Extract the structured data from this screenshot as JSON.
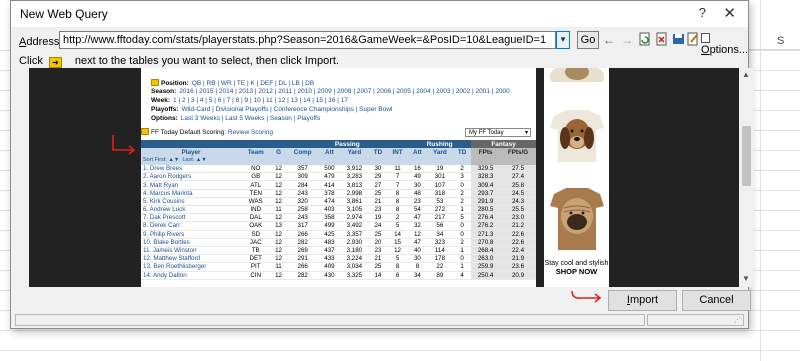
{
  "excel": {
    "column_label": "S"
  },
  "dialog": {
    "title": "New Web Query",
    "help": "?",
    "close": "✕",
    "address_label_underlined": "A",
    "address_label_rest": "ddress:",
    "address_value": "http://www.fftoday.com/stats/playerstats.php?Season=2016&GameWeek=&PosID=10&LeagueID=1",
    "go_label": "Go",
    "options_underlined": "O",
    "options_rest": "ptions...",
    "instruction_click": "Click",
    "instruction_rest": "next to the tables you want to select, then click Import.",
    "import_underlined": "I",
    "import_rest": "mport",
    "cancel_label": "Cancel"
  },
  "webpage": {
    "nav": {
      "position_label": "Position:",
      "positions": [
        "QB",
        "RB",
        "WR",
        "TE",
        "K",
        "DEF",
        "DL",
        "LB",
        "DB"
      ],
      "season_label": "Season:",
      "seasons": [
        "2016",
        "2015",
        "2014",
        "2013",
        "2012",
        "2011",
        "2010",
        "2009",
        "2008",
        "2007",
        "2006",
        "2005",
        "2004",
        "2003",
        "2002",
        "2001",
        "2000"
      ],
      "week_label": "Week:",
      "weeks": [
        "1",
        "2",
        "3",
        "4",
        "5",
        "6",
        "7",
        "8",
        "9",
        "10",
        "11",
        "12",
        "13",
        "14",
        "15",
        "16",
        "17"
      ],
      "playoffs_label": "Playoffs:",
      "playoffs": [
        "Wild-Card",
        "Divisional Playoffs",
        "Conference Championships",
        "Super Bowl"
      ],
      "options_label": "Options:",
      "options": [
        "Last 3 Weeks",
        "Last 5 Weeks",
        "Season",
        "Playoffs"
      ]
    },
    "scoring_prefix": "FF Today Default Scoring:",
    "scoring_link": "Review Scoring",
    "myff_select": "My FF Today",
    "table": {
      "groups": {
        "passing": "Passing",
        "rushing": "Rushing",
        "fantasy": "Fantasy"
      },
      "headers": [
        "Player",
        "Team",
        "G",
        "Comp",
        "Att",
        "Yard",
        "TD",
        "INT",
        "Att",
        "Yard",
        "TD",
        "FPts",
        "FPts/G"
      ],
      "sort_first": "Sort First:",
      "sort_last": "Last:",
      "rows": [
        [
          "1. Drew Brees",
          "NO",
          "12",
          "357",
          "500",
          "3,912",
          "30",
          "11",
          "16",
          "19",
          "2",
          "329.5",
          "27.5"
        ],
        [
          "2. Aaron Rodgers",
          "GB",
          "12",
          "309",
          "479",
          "3,283",
          "29",
          "7",
          "49",
          "301",
          "3",
          "328.3",
          "27.4"
        ],
        [
          "3. Matt Ryan",
          "ATL",
          "12",
          "284",
          "414",
          "3,813",
          "27",
          "7",
          "30",
          "107",
          "0",
          "309.4",
          "25.8"
        ],
        [
          "4. Marcus Mariota",
          "TEN",
          "12",
          "243",
          "378",
          "2,998",
          "25",
          "8",
          "48",
          "318",
          "2",
          "293.7",
          "24.5"
        ],
        [
          "5. Kirk Cousins",
          "WAS",
          "12",
          "320",
          "474",
          "3,861",
          "21",
          "8",
          "23",
          "53",
          "2",
          "291.9",
          "24.3"
        ],
        [
          "6. Andrew Luck",
          "IND",
          "11",
          "258",
          "403",
          "3,105",
          "23",
          "8",
          "54",
          "272",
          "1",
          "280.5",
          "25.5"
        ],
        [
          "7. Dak Prescott",
          "DAL",
          "12",
          "243",
          "358",
          "2,974",
          "19",
          "2",
          "47",
          "217",
          "5",
          "276.4",
          "23.0"
        ],
        [
          "8. Derek Carr",
          "OAK",
          "13",
          "317",
          "499",
          "3,492",
          "24",
          "5",
          "32",
          "56",
          "0",
          "276.2",
          "21.2"
        ],
        [
          "9. Philip Rivers",
          "SD",
          "12",
          "266",
          "425",
          "3,357",
          "25",
          "14",
          "12",
          "34",
          "0",
          "271.3",
          "22.6"
        ],
        [
          "10. Blake Bortles",
          "JAC",
          "12",
          "282",
          "483",
          "2,930",
          "20",
          "15",
          "47",
          "323",
          "2",
          "270.8",
          "22.6"
        ],
        [
          "11. Jameis Winston",
          "TB",
          "12",
          "269",
          "437",
          "3,180",
          "23",
          "12",
          "40",
          "114",
          "1",
          "268.4",
          "22.4"
        ],
        [
          "12. Matthew Stafford",
          "DET",
          "12",
          "291",
          "433",
          "3,224",
          "21",
          "5",
          "30",
          "178",
          "0",
          "263.0",
          "21.9"
        ],
        [
          "13. Ben Roethlisberger",
          "PIT",
          "11",
          "266",
          "409",
          "3,034",
          "25",
          "8",
          "8",
          "22",
          "1",
          "259.9",
          "23.6"
        ],
        [
          "14. Andy Dalton",
          "CIN",
          "12",
          "282",
          "430",
          "3,325",
          "14",
          "6",
          "34",
          "89",
          "4",
          "250.4",
          "20.9"
        ]
      ]
    }
  },
  "ad": {
    "line1": "Stay cool and stylish",
    "line2": "SHOP NOW"
  }
}
